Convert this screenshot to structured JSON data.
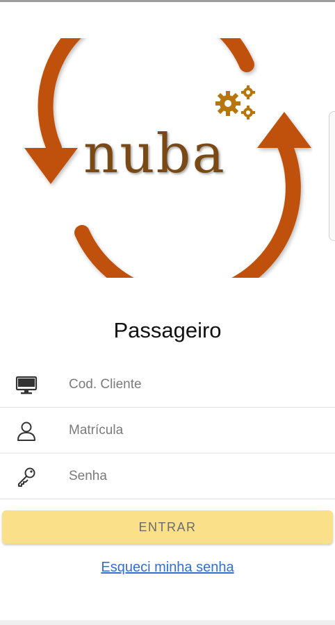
{
  "app": {
    "logo_text": "nuba"
  },
  "login": {
    "title": "Passageiro",
    "fields": [
      {
        "placeholder": "Cod. Cliente",
        "icon": "monitor-icon"
      },
      {
        "placeholder": "Matrícula",
        "icon": "user-icon"
      },
      {
        "placeholder": "Senha",
        "icon": "key-icon"
      }
    ],
    "enter_label": "ENTRAR",
    "forgot_label": "Esqueci minha senha"
  },
  "colors": {
    "brand_orange": "#c0510c",
    "gear_gold": "#b8750b",
    "logo_text": "#7a4a16",
    "button_bg": "#fbe08a",
    "link": "#2f6fd6"
  }
}
